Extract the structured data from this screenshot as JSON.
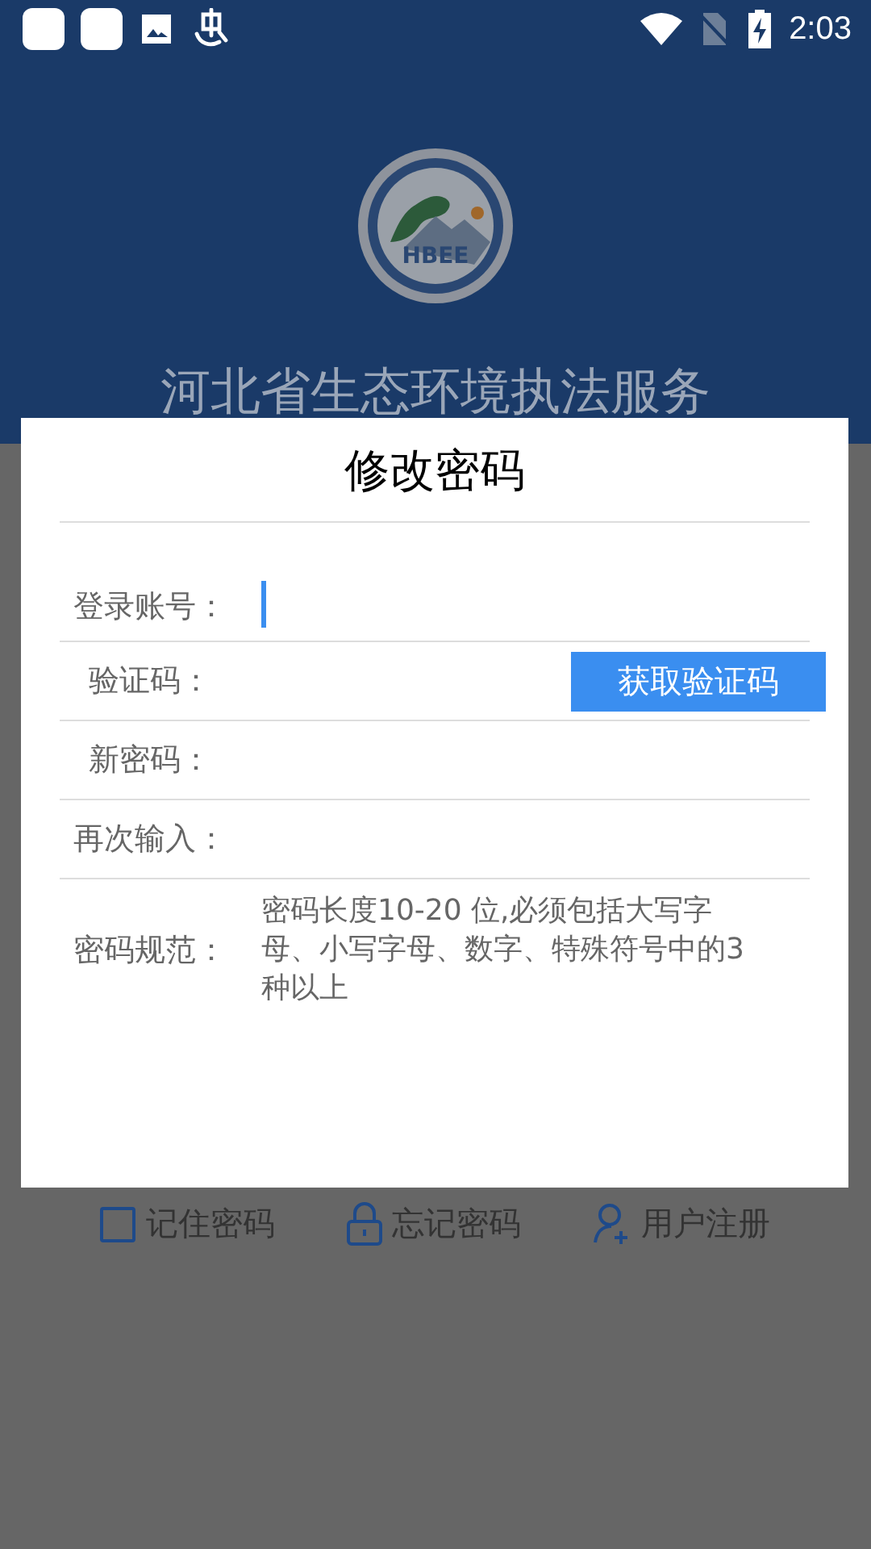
{
  "status_bar": {
    "time": "2:03"
  },
  "header": {
    "logo_text": "HBEE",
    "title": "河北省生态环境执法服务"
  },
  "dialog": {
    "title": "修改密码",
    "fields": [
      {
        "kind": "input",
        "label": "登录账号：",
        "focused": true
      },
      {
        "kind": "code",
        "label": "验证码：",
        "focused": false,
        "button": "获取验证码"
      },
      {
        "kind": "input",
        "label": "新密码：",
        "focused": false
      },
      {
        "kind": "input",
        "label": "再次输入：",
        "focused": false
      },
      {
        "kind": "note",
        "label": "密码规范：",
        "note": "密码长度10-20 位,必须包括大写字母、小写字母、数字、特殊符号中的3种以上"
      }
    ]
  },
  "options": [
    {
      "kind": "checkbox",
      "label": "记住密码",
      "checked": false
    },
    {
      "kind": "lock",
      "label": "忘记密码"
    },
    {
      "kind": "user-add",
      "label": "用户注册"
    }
  ]
}
